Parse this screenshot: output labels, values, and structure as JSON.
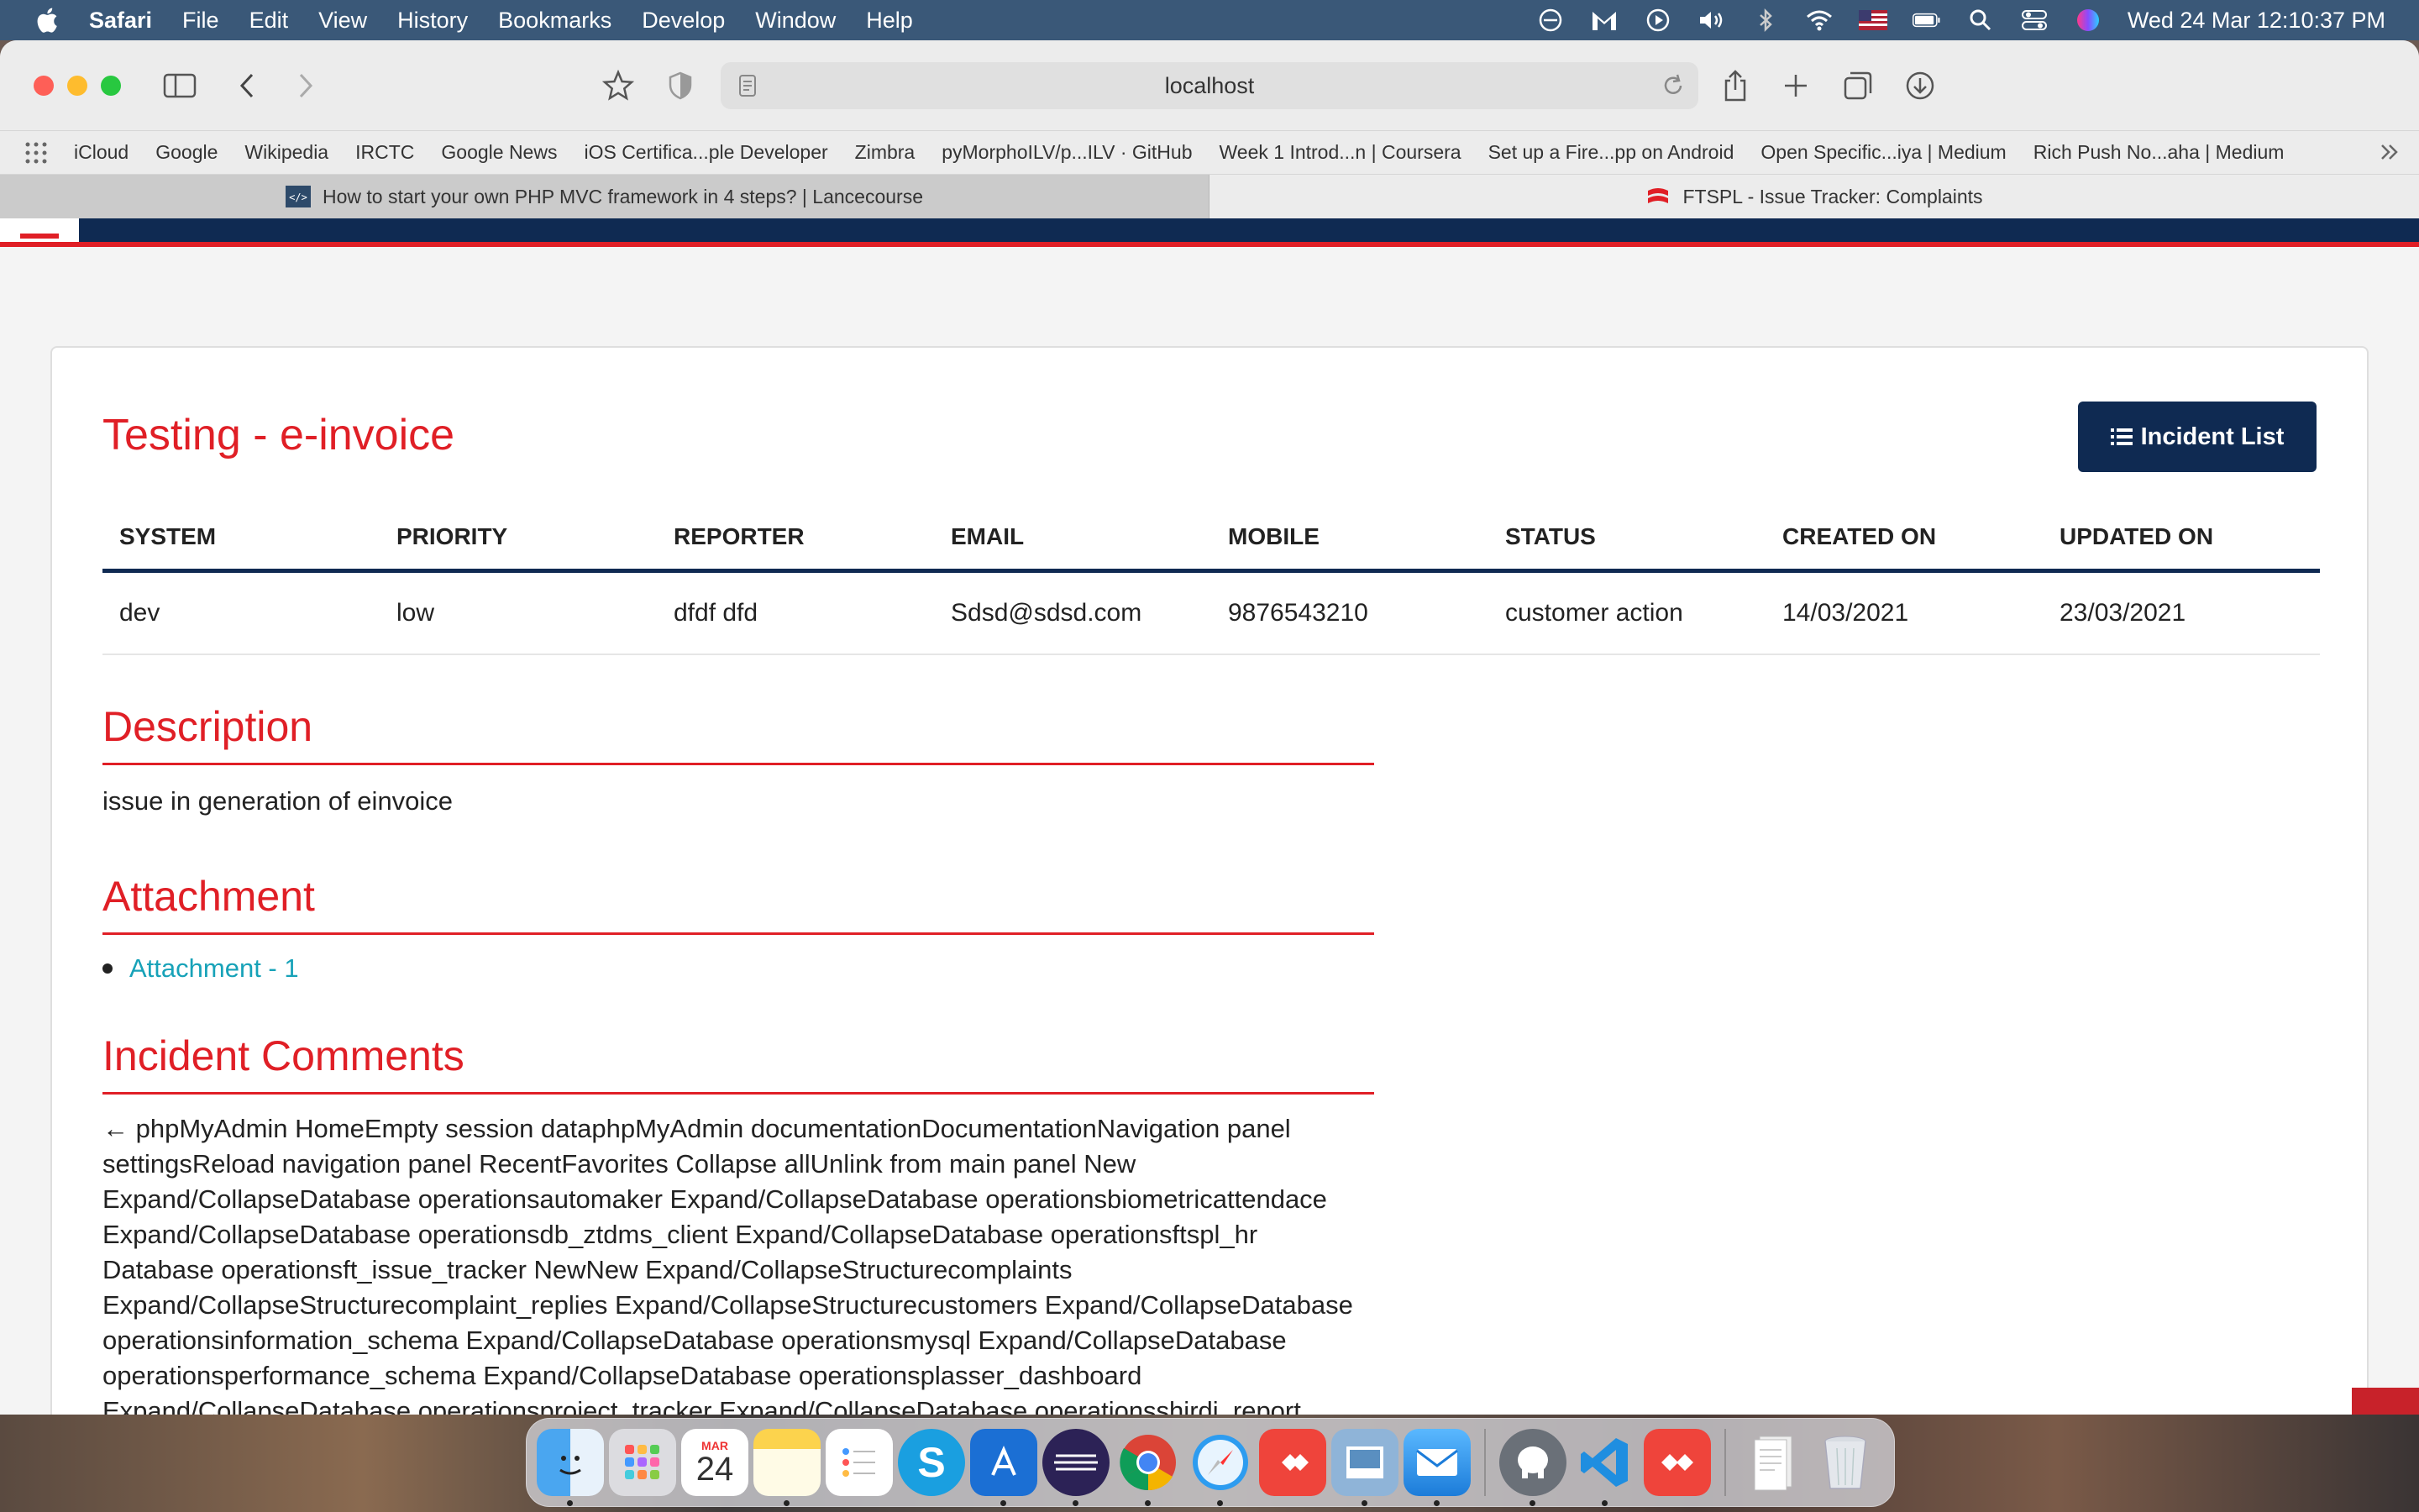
{
  "menubar": {
    "app_name": "Safari",
    "items": [
      "File",
      "Edit",
      "View",
      "History",
      "Bookmarks",
      "Develop",
      "Window",
      "Help"
    ],
    "clock": "Wed 24 Mar  12:10:37 PM",
    "status_icons": [
      "focus-icon",
      "gmail-icon",
      "play-icon",
      "volume-icon",
      "bluetooth-icon",
      "wifi-icon",
      "us-flag-icon",
      "battery-icon",
      "spotlight-icon",
      "control-center-icon",
      "siri-icon"
    ]
  },
  "browser": {
    "address": "localhost",
    "bookmarks": [
      "iCloud",
      "Google",
      "Wikipedia",
      "IRCTC",
      "Google News",
      "iOS Certifica...ple Developer",
      "Zimbra",
      "pyMorphoILV/p...ILV · GitHub",
      "Week 1 Introd...n | Coursera",
      "Set up a Fire...pp on Android",
      "Open Specific...iya | Medium",
      "Rich Push No...aha | Medium"
    ],
    "tabs": [
      {
        "title": "How to start your own PHP MVC framework in 4 steps? | Lancecourse"
      },
      {
        "title": "FTSPL - Issue Tracker: Complaints"
      }
    ]
  },
  "page": {
    "title": "Testing - e-invoice",
    "incident_list_label": "Incident List",
    "table": {
      "headers": [
        "SYSTEM",
        "PRIORITY",
        "REPORTER",
        "EMAIL",
        "MOBILE",
        "STATUS",
        "CREATED ON",
        "UPDATED ON"
      ],
      "row": [
        "dev",
        "low",
        "dfdf dfd",
        "Sdsd@sdsd.com",
        "9876543210",
        "customer action",
        "14/03/2021",
        "23/03/2021"
      ]
    },
    "description": {
      "heading": "Description",
      "text": "issue in generation of einvoice"
    },
    "attachment": {
      "heading": "Attachment",
      "items": [
        "Attachment - 1"
      ]
    },
    "comments": {
      "heading": "Incident Comments",
      "text": "← phpMyAdmin HomeEmpty session dataphpMyAdmin documentationDocumentationNavigation panel settingsReload navigation panel RecentFavorites Collapse allUnlink from main panel New Expand/CollapseDatabase operationsautomaker Expand/CollapseDatabase operationsbiometricattendace Expand/CollapseDatabase operationsdb_ztdms_client Expand/CollapseDatabase operationsftspl_hr Database operationsft_issue_tracker NewNew Expand/CollapseStructurecomplaints Expand/CollapseStructurecomplaint_replies Expand/CollapseStructurecustomers Expand/CollapseDatabase operationsinformation_schema Expand/CollapseDatabase operationsmysql Expand/CollapseDatabase operationsperformance_schema Expand/CollapseDatabase operationsplasser_dashboard Expand/CollapseDatabase operationsproject_tracker Expand/CollapseDatabase operationsshirdi_report Expand/CollapseDatabase"
    }
  },
  "dock": {
    "calendar_month": "MAR",
    "calendar_day": "24",
    "apps": [
      "finder-icon",
      "launchpad-icon",
      "calendar-icon",
      "notes-icon",
      "reminders-icon",
      "skype-icon",
      "xcode-icon",
      "eclipse-icon",
      "chrome-icon",
      "safari-icon",
      "anydesk-icon",
      "preview-icon",
      "mail-icon",
      "tableplus-icon",
      "vscode-icon",
      "anydesk2-icon",
      "documents-icon",
      "trash-icon"
    ]
  }
}
